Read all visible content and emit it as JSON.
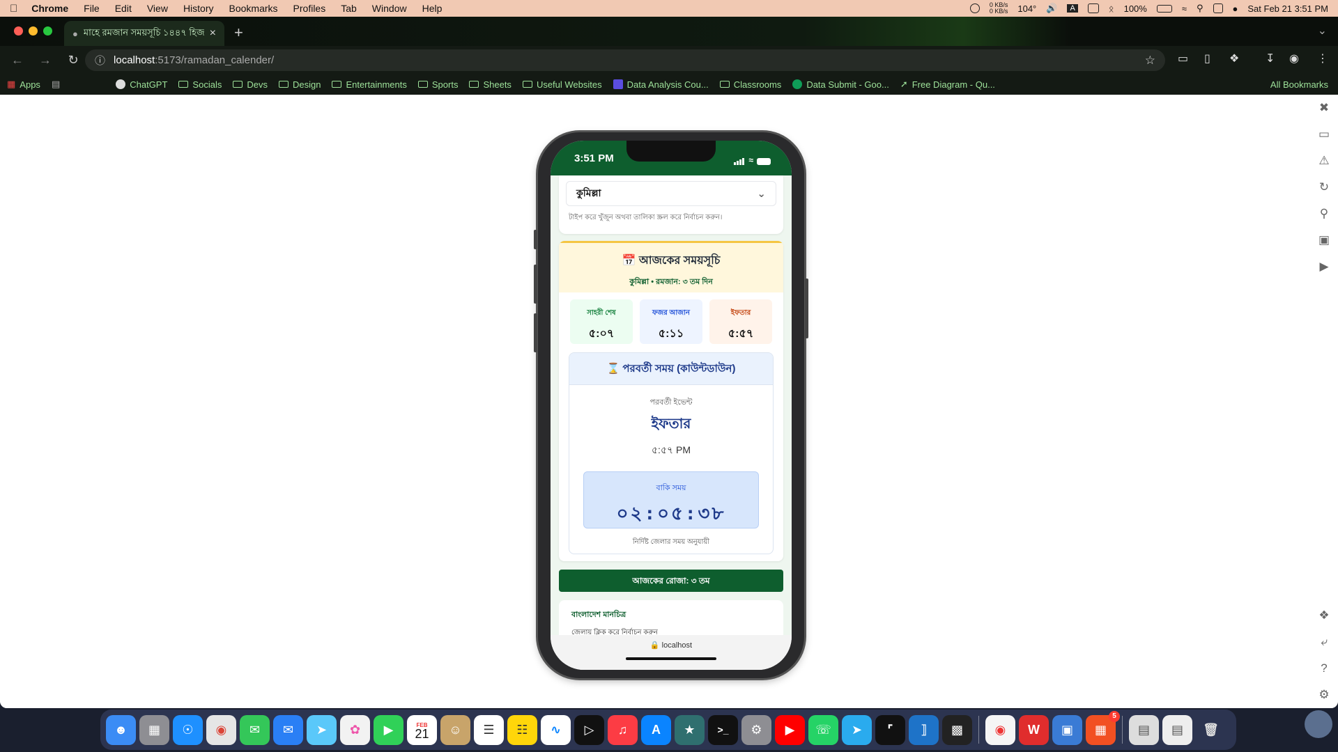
{
  "menubar": {
    "app": "Chrome",
    "items": [
      "File",
      "Edit",
      "View",
      "History",
      "Bookmarks",
      "Profiles",
      "Tab",
      "Window",
      "Help"
    ],
    "temp": "104°",
    "battery": "100%",
    "datetime": "Sat Feb 21  3:51 PM",
    "net_up": "0 KB/s",
    "net_down": "0 KB/s"
  },
  "browser": {
    "tab_title": "মাহে রমজান সময়সূচি ১৪৪৭ হিজ",
    "url_host": "localhost",
    "url_path": ":5173/ramadan_calender/",
    "bookmarks": [
      {
        "label": "Apps",
        "type": "app"
      },
      {
        "label": "ChatGPT",
        "type": "site"
      },
      {
        "label": "Socials",
        "type": "folder"
      },
      {
        "label": "Devs",
        "type": "folder"
      },
      {
        "label": "Design",
        "type": "folder"
      },
      {
        "label": "Entertainments",
        "type": "folder"
      },
      {
        "label": "Sports",
        "type": "folder"
      },
      {
        "label": "Sheets",
        "type": "folder"
      },
      {
        "label": "Useful Websites",
        "type": "folder"
      },
      {
        "label": "Data Analysis Cou...",
        "type": "site"
      },
      {
        "label": "Classrooms",
        "type": "folder"
      },
      {
        "label": "Data Submit - Goo...",
        "type": "site"
      },
      {
        "label": "Free Diagram - Qu...",
        "type": "site"
      }
    ],
    "all_bookmarks": "All Bookmarks"
  },
  "phone": {
    "time": "3:51 PM",
    "district": {
      "selected": "কুমিল্লা",
      "hint": "টাইপ করে খুঁজুন অথবা তালিকা স্ক্রল করে নির্বাচন করুন।"
    },
    "schedule": {
      "title": "আজকের সময়সূচি",
      "subtitle": "কুমিল্লা • রমজান: ৩ তম দিন",
      "sehri_label": "সাহরী শেষ",
      "sehri_time": "৫:০৭",
      "fajr_label": "ফজর আজান",
      "fajr_time": "৫:১১",
      "iftar_label": "ইফতার",
      "iftar_time": "৫:৫৭"
    },
    "countdown": {
      "title": "পরবর্তী সময় (কাউন্টডাউন)",
      "next_label": "পরবর্তী ইভেন্ট",
      "event": "ইফতার",
      "event_time": "৫:৫৭ PM",
      "remain_label": "বাকি সময়",
      "remain": "০২:০৫:৩৮",
      "note": "নির্দিষ্ট জেলার সময় অনুযায়ী"
    },
    "roza": "আজকের রোজা: ৩ তম",
    "map": {
      "title": "বাংলাদেশ মানচিত্র",
      "subtitle": "জেলায় ক্লিক করে নির্বাচন করুন"
    },
    "safari_host": "localhost"
  },
  "dock": {
    "calendar_month": "FEB",
    "calendar_day": "21",
    "badge": "5"
  },
  "colors": {
    "brand_green": "#0e5e2e",
    "accent_yellow": "#f5c542",
    "countdown_blue": "#1e3a8a"
  }
}
